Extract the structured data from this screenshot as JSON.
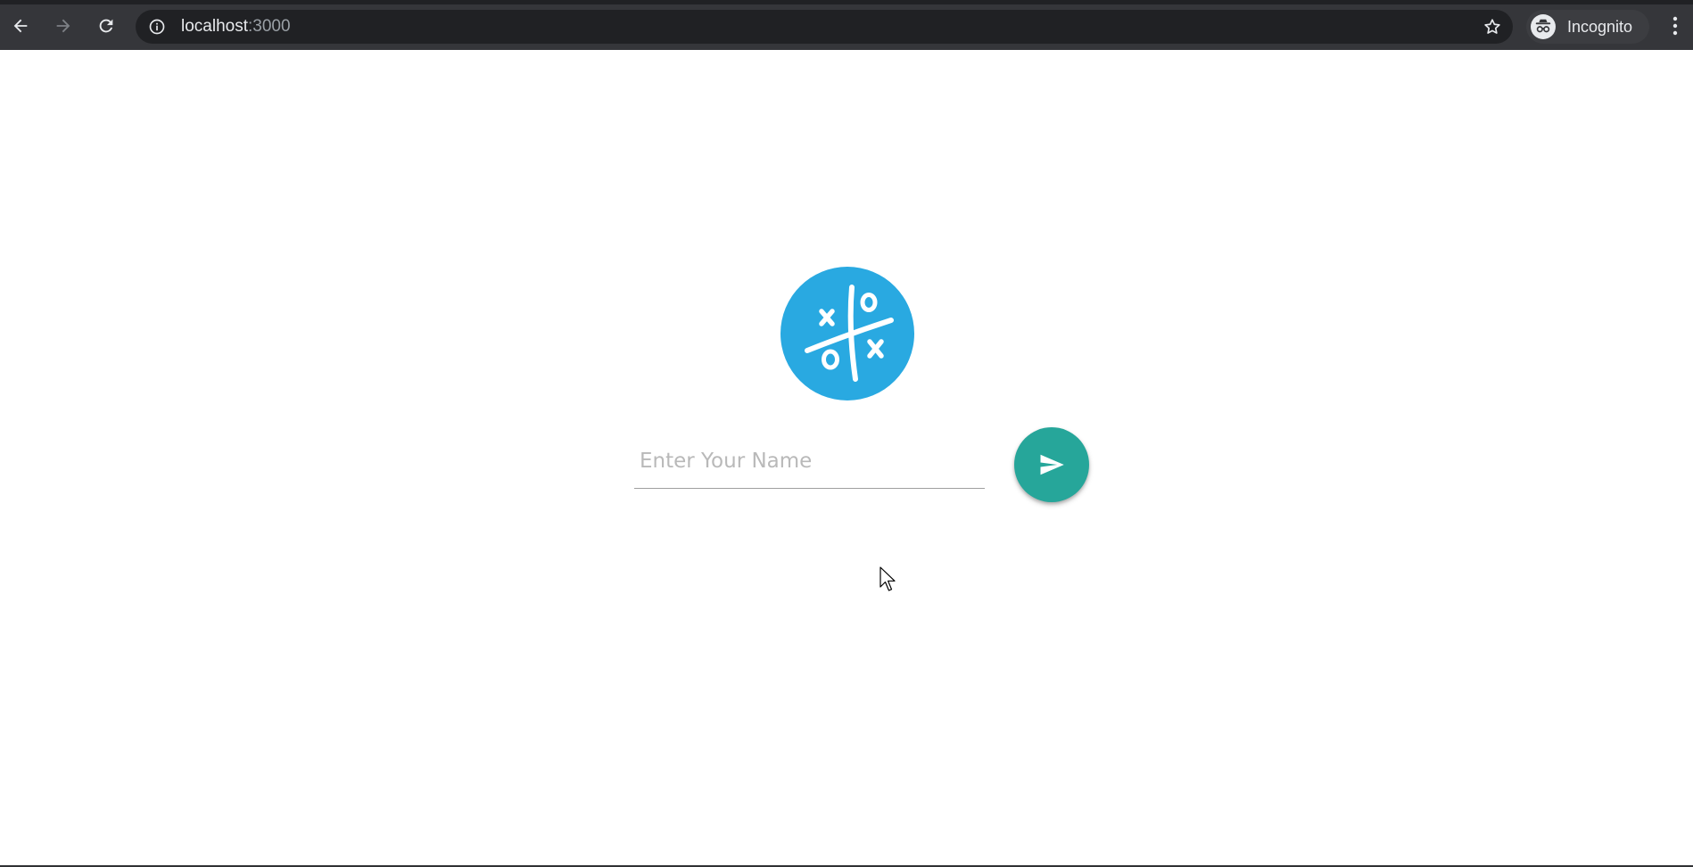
{
  "browser": {
    "url_host": "localhost",
    "url_port": ":3000",
    "profile_label": "Incognito",
    "icons": {
      "back": "back-arrow-icon",
      "forward": "forward-arrow-icon",
      "reload": "reload-icon",
      "info": "info-icon",
      "bookmark": "star-icon",
      "incognito": "incognito-icon",
      "menu": "kebab-menu-icon"
    }
  },
  "app": {
    "logo": "tic-tac-toe-logo",
    "name_input": {
      "value": "",
      "placeholder": "Enter Your Name"
    },
    "submit_icon": "send-icon",
    "colors": {
      "logo_bg": "#29a9e1",
      "submit_bg": "#26a69a"
    }
  }
}
